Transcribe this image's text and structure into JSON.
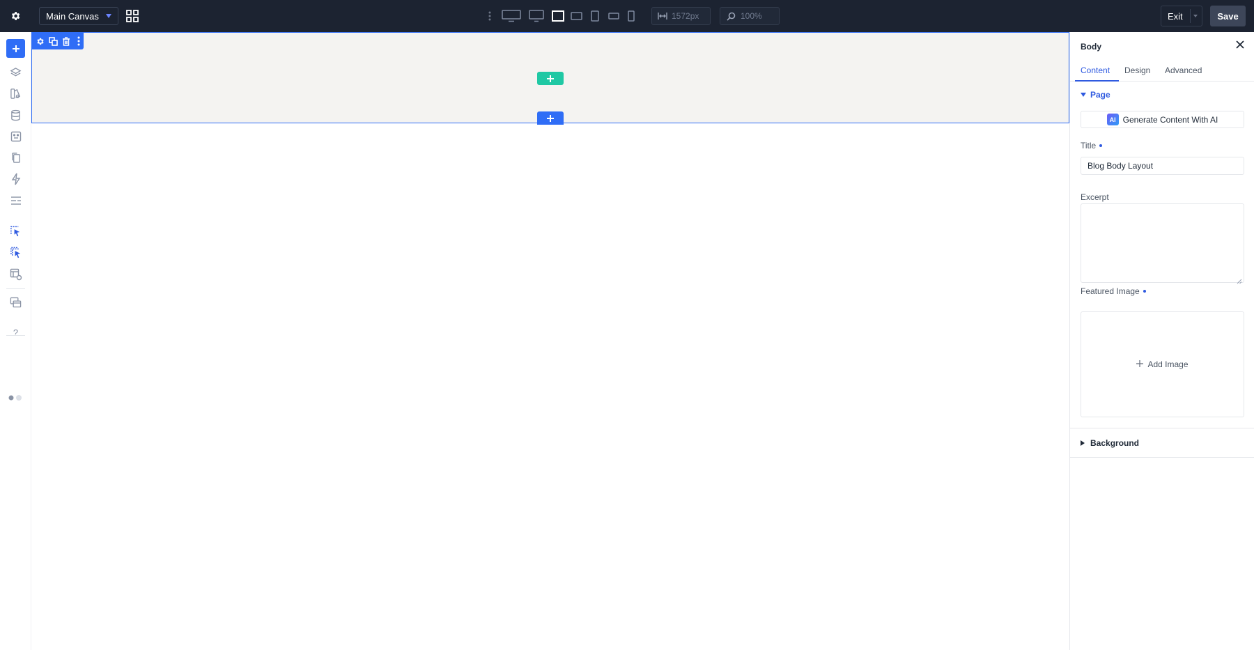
{
  "topbar": {
    "canvas_selector": "Main Canvas",
    "width_value": "1572px",
    "zoom_value": "100%",
    "exit_label": "Exit",
    "save_label": "Save"
  },
  "canvas": {
    "section_tools": [
      "gear-icon",
      "duplicate-icon",
      "trash-icon",
      "more-vertical-icon"
    ]
  },
  "panel": {
    "title": "Body",
    "tabs": [
      {
        "label": "Content",
        "active": true
      },
      {
        "label": "Design",
        "active": false
      },
      {
        "label": "Advanced",
        "active": false
      }
    ],
    "page_section": "Page",
    "ai_button": "Generate Content With AI",
    "ai_badge": "AI",
    "title_label": "Title",
    "title_value": "Blog Body Layout",
    "excerpt_label": "Excerpt",
    "excerpt_value": "",
    "featured_image_label": "Featured Image",
    "add_image_label": "Add Image",
    "background_section": "Background"
  },
  "colors": {
    "topbar_bg": "#1c2331",
    "accent_blue": "#2f6df6",
    "accent_green": "#1fc8a4",
    "canvas_bg": "#f4f3f1"
  }
}
